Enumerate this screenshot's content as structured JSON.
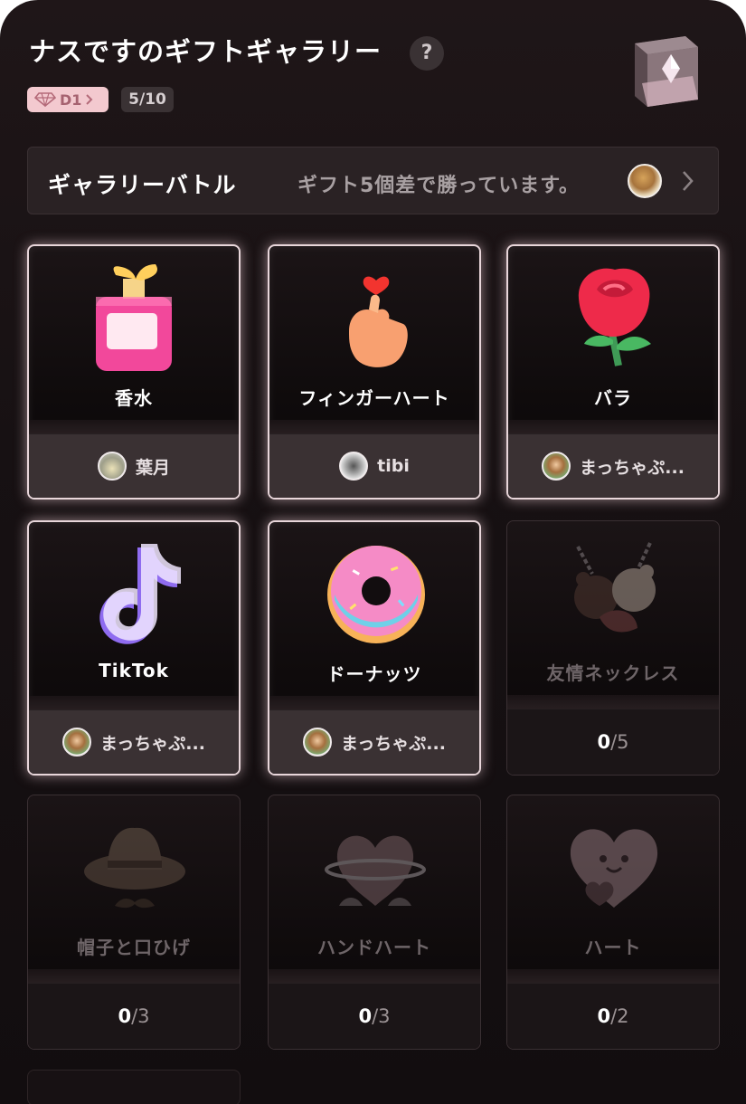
{
  "header": {
    "title": "ナスですのギフトギャラリー",
    "help_label": "?",
    "level_label": "D1",
    "count_label": "5/10"
  },
  "battle": {
    "title": "ギャラリーバトル",
    "status": "ギフト5個差で勝っています。"
  },
  "gifts": [
    {
      "name": "香水",
      "owned": true,
      "sender": "葉月"
    },
    {
      "name": "フィンガーハート",
      "owned": true,
      "sender": "tibi"
    },
    {
      "name": "バラ",
      "owned": true,
      "sender": "まっちゃぷ..."
    },
    {
      "name": "TikTok",
      "owned": true,
      "sender": "まっちゃぷ..."
    },
    {
      "name": "ドーナッツ",
      "owned": true,
      "sender": "まっちゃぷ..."
    },
    {
      "name": "友情ネックレス",
      "owned": false,
      "have": "0",
      "total": "/5"
    },
    {
      "name": "帽子と口ひげ",
      "owned": false,
      "have": "0",
      "total": "/3"
    },
    {
      "name": "ハンドハート",
      "owned": false,
      "have": "0",
      "total": "/3"
    },
    {
      "name": "ハート",
      "owned": false,
      "have": "0",
      "total": "/2"
    }
  ],
  "colors": {
    "background": "#171113",
    "badge_pink": "#f3c9cf",
    "badge_text": "#a66270",
    "owned_glow": "#e8d6da"
  },
  "icons": [
    "help-icon",
    "diamond-icon",
    "chevron-right-icon",
    "crystal-cube-icon"
  ]
}
